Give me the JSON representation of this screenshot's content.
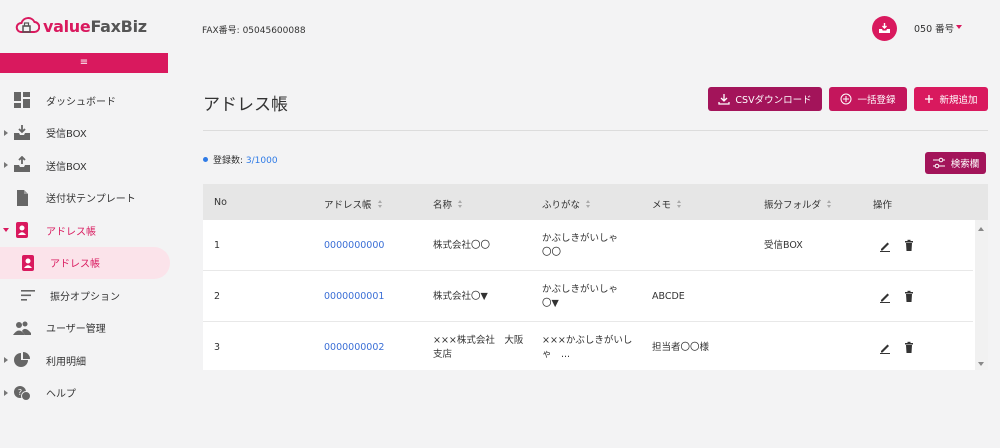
{
  "app": {
    "logo_part1": "value",
    "logo_part2": "FaxBiz",
    "collapse_icon": "≡"
  },
  "header": {
    "fax_label": "FAX番号: 05045600088",
    "user_label": "050 番号"
  },
  "sidebar": {
    "items": [
      {
        "label": "ダッシュボード",
        "icon": "dashboard-icon"
      },
      {
        "label": "受信BOX",
        "icon": "inbox-icon"
      },
      {
        "label": "送信BOX",
        "icon": "outbox-icon"
      },
      {
        "label": "送付状テンプレート",
        "icon": "document-icon"
      },
      {
        "label": "アドレス帳",
        "icon": "contact-icon"
      },
      {
        "label": "アドレス帳",
        "icon": "contact-icon"
      },
      {
        "label": "振分オプション",
        "icon": "sort-icon"
      },
      {
        "label": "ユーザー管理",
        "icon": "users-icon"
      },
      {
        "label": "利用明細",
        "icon": "pie-chart-icon"
      },
      {
        "label": "ヘルプ",
        "icon": "help-icon"
      }
    ]
  },
  "main": {
    "title": "アドレス帳",
    "buttons": {
      "csv": "CSVダウンロード",
      "bulk": "一括登録",
      "new": "新規追加",
      "search": "検索欄"
    },
    "count_label": "登録数: ",
    "count_value": "3/1000"
  },
  "table": {
    "headers": [
      "No",
      "アドレス帳",
      "名称",
      "ふりがな",
      "メモ",
      "振分フォルダ",
      "操作"
    ],
    "rows": [
      {
        "no": "1",
        "address": "0000000000",
        "name1": "株式会社〇〇",
        "name2": "",
        "kana1": "かぶしきがいしゃ",
        "kana2": "〇〇",
        "memo": "",
        "folder": "受信BOX"
      },
      {
        "no": "2",
        "address": "0000000001",
        "name1": "株式会社〇▼",
        "name2": "",
        "kana1": "かぶしきがいしゃ",
        "kana2": "〇▼",
        "memo": "ABCDE",
        "folder": ""
      },
      {
        "no": "3",
        "address": "0000000002",
        "name1": "×××株式会社　大阪",
        "name2": "支店",
        "kana1": "×××かぶしきがいし",
        "kana2": "ゃ　...",
        "memo": "担当者〇〇様",
        "folder": ""
      }
    ]
  },
  "colors": {
    "brand": "#d9195e",
    "brand_dark": "#a3145a",
    "link": "#3b6fd6"
  }
}
